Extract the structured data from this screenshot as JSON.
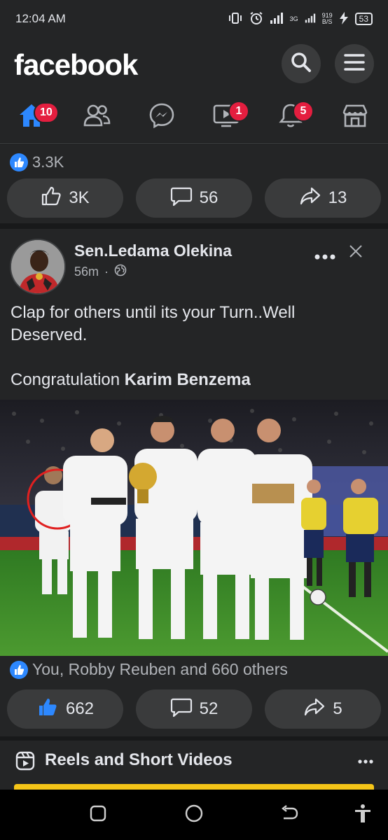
{
  "status_bar": {
    "time": "12:04 AM",
    "network_type": "3G",
    "speed_value": "919",
    "speed_unit": "B/S",
    "battery": "53"
  },
  "header": {
    "logo": "facebook",
    "search_icon": "search-icon",
    "menu_icon": "menu-icon"
  },
  "nav": {
    "home_badge": "10",
    "video_badge": "1",
    "notifications_badge": "5",
    "accent_color": "#2d88ff",
    "badge_color": "#e41e3f"
  },
  "post1": {
    "reaction_count": "3.3K",
    "like_count": "3K",
    "comment_count": "56",
    "share_count": "13"
  },
  "post2": {
    "author": "Sen.Ledama Olekina",
    "time": "56m",
    "separator": "·",
    "text_line1": "Clap for others until its your Turn..Well Deserved.",
    "text_prefix": "Congratulation ",
    "text_bold": "Karim Benzema",
    "reactions_summary": "You, Robby Reuben and 660 others",
    "like_count": "662",
    "comment_count": "52",
    "share_count": "5"
  },
  "reels": {
    "title": "Reels and Short Videos"
  }
}
